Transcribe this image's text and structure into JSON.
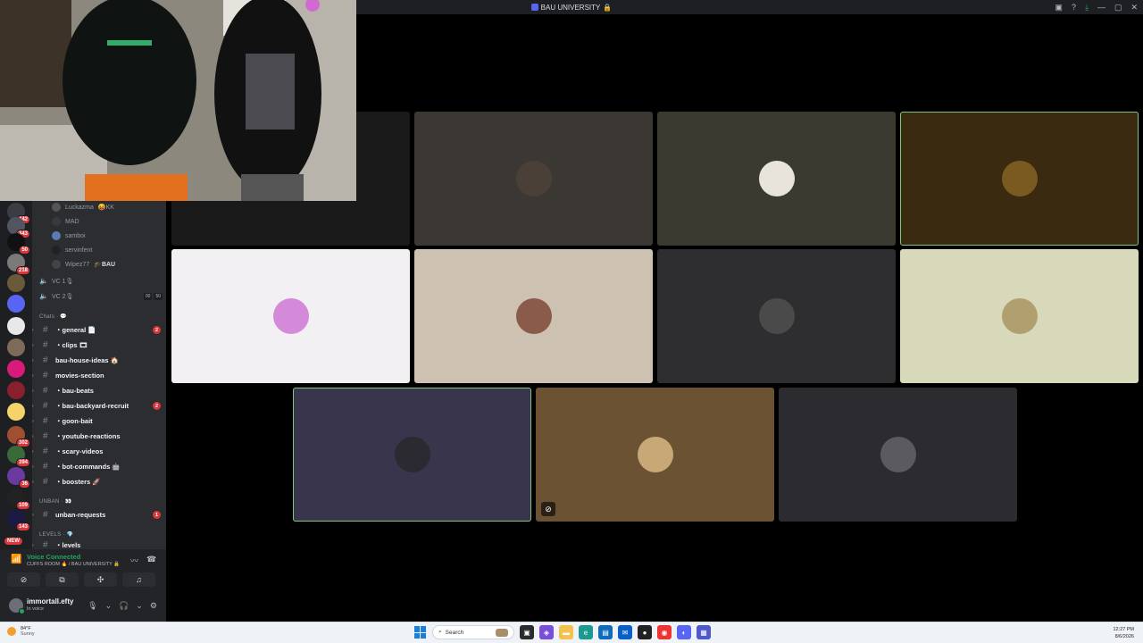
{
  "window": {
    "title": "BAU UNIVERSITY",
    "title_emoji": "🔒"
  },
  "voice_users": [
    {
      "name": "Luckazma",
      "suffix": "😝KK"
    },
    {
      "name": "MAD",
      "suffix": ""
    },
    {
      "name": "samboi",
      "suffix": ""
    },
    {
      "name": "servinfent",
      "suffix": ""
    },
    {
      "name": "Wipez77",
      "suffix": "🎓BAU"
    }
  ],
  "voice_channels": [
    {
      "name": "VC 1🎙",
      "count_a": "",
      "count_b": ""
    },
    {
      "name": "VC 2🎙",
      "count_a": "00",
      "count_b": "50"
    }
  ],
  "categories": {
    "chats": "Chats · 💬",
    "unban": "UNBAN · 👀",
    "levels": "LEVELS · 💎"
  },
  "channels": [
    {
      "name": "・general 📄",
      "unread": "2"
    },
    {
      "name": "・clips 🎞",
      "unread": ""
    },
    {
      "name": "bau-house-ideas 🏠",
      "unread": ""
    },
    {
      "name": "movies-section",
      "unread": ""
    },
    {
      "name": "・bau-beats",
      "unread": ""
    },
    {
      "name": "・bau-backyard-recruit",
      "unread": "2"
    },
    {
      "name": "・goon-bait",
      "unread": ""
    },
    {
      "name": "・youtube-reactions",
      "unread": ""
    },
    {
      "name": "・scary-videos",
      "unread": ""
    },
    {
      "name": "・bot-commands 🤖",
      "unread": ""
    },
    {
      "name": "・boosters 🚀",
      "unread": ""
    },
    {
      "name": "unban-requests",
      "unread": "1"
    },
    {
      "name": "・levels",
      "unread": ""
    }
  ],
  "servers": [
    {
      "badge": "442",
      "color": "#3b3d44"
    },
    {
      "badge": "343",
      "color": "#505560"
    },
    {
      "badge": "50",
      "color": "#111111"
    },
    {
      "badge": "218",
      "color": "#7a7a7a"
    },
    {
      "badge": "",
      "color": "#6b5a3a"
    },
    {
      "badge": "",
      "color": "#5865f2"
    },
    {
      "badge": "",
      "color": "#e8e8e8"
    },
    {
      "badge": "",
      "color": "#7d6b5a"
    },
    {
      "badge": "",
      "color": "#d81b7a"
    },
    {
      "badge": "",
      "color": "#8a1f2d"
    },
    {
      "badge": "",
      "color": "#f5d36a"
    },
    {
      "badge": "302",
      "color": "#a05030"
    },
    {
      "badge": "394",
      "color": "#3a6a3a"
    },
    {
      "badge": "36",
      "color": "#6b3aa0"
    },
    {
      "badge": "109",
      "color": "#222222"
    },
    {
      "badge": "143",
      "color": "#1a1a44"
    }
  ],
  "new_badge": "NEW",
  "voice_panel": {
    "status": "Voice Connected",
    "location": "CUFFS ROOM 🔥 / BAU UNIVERSITY 🔒"
  },
  "user": {
    "name": "immortall.efty",
    "status": "In voice"
  },
  "tiles": [
    {
      "bg": "#3b3733",
      "avatar": "#4a4038",
      "speaking": false
    },
    {
      "bg": "#3b3a30",
      "avatar": "#e8e4dc",
      "speaking": false
    },
    {
      "bg": "#3a2a10",
      "avatar": "#7a5a20",
      "speaking": true
    },
    {
      "bg": "#f2f0f3",
      "avatar": "#d48ad8",
      "speaking": false
    },
    {
      "bg": "#cdc1b2",
      "avatar": "#8a5a4a",
      "speaking": false
    },
    {
      "bg": "#2e2e30",
      "avatar": "#4a4a4a",
      "speaking": false
    },
    {
      "bg": "#d8d8ba",
      "avatar": "#b0a070",
      "speaking": false
    },
    {
      "bg": "#38354c",
      "avatar": "#2a2a30",
      "speaking": true
    },
    {
      "bg": "#6b5232",
      "avatar": "#c9a878",
      "speaking": false
    },
    {
      "bg": "#2b2b30",
      "avatar": "#5a5a60",
      "speaking": false
    }
  ],
  "taskbar": {
    "temp": "84°F",
    "weather": "Sunny",
    "search": "Search",
    "time": "12:27 PM",
    "date": "8/6/2026"
  }
}
